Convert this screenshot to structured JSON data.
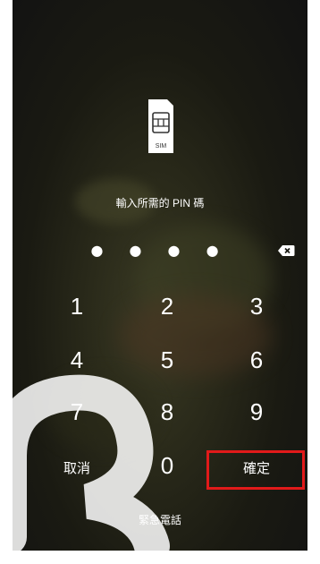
{
  "sim": {
    "icon": "sim-card-icon",
    "label": "SIM"
  },
  "prompt": "輸入所需的 PIN 碼",
  "pin_entry": {
    "dots": "● ● ● ●",
    "digits_entered": 4
  },
  "backspace_icon": "backspace-icon",
  "keypad": {
    "k1": "1",
    "k2": "2",
    "k3": "3",
    "k4": "4",
    "k5": "5",
    "k6": "6",
    "k7": "7",
    "k8": "8",
    "k9": "9",
    "cancel": "取消",
    "k0": "0",
    "confirm": "確定"
  },
  "emergency_call": "緊急電話",
  "colors": {
    "highlight": "#e11a1a",
    "text": "#ffffff"
  }
}
